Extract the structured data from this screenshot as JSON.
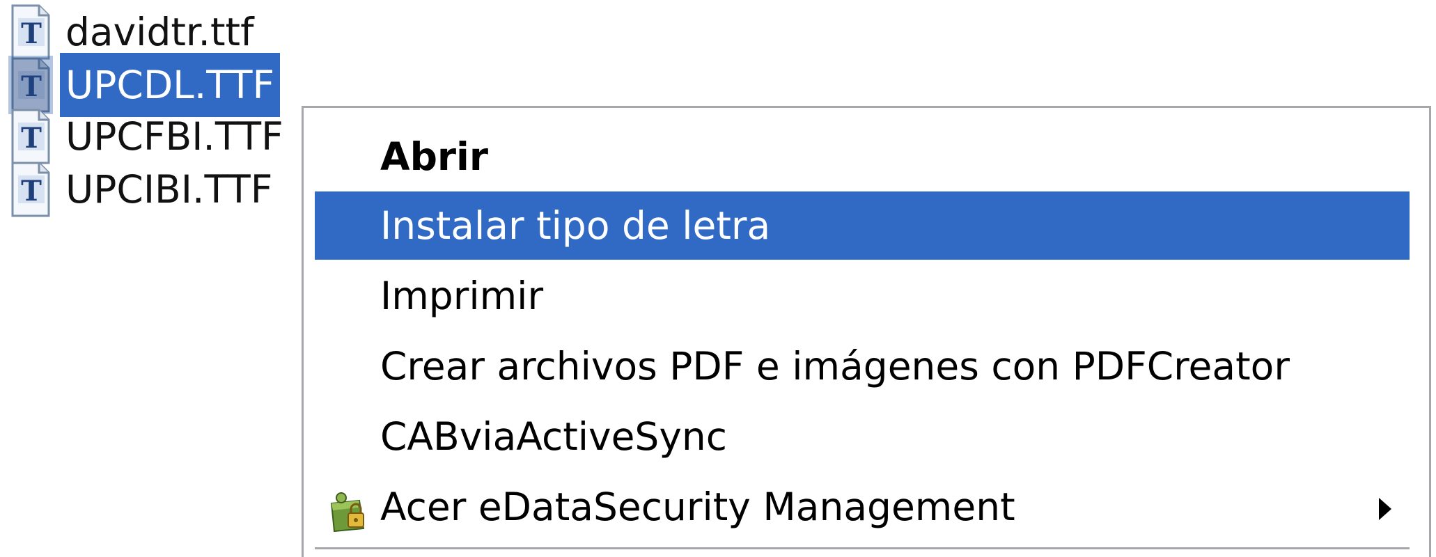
{
  "files": [
    {
      "name": "davidtr.ttf",
      "icon": "font-file-icon",
      "selected": false
    },
    {
      "name": "UPCDL.TTF",
      "icon": "font-file-icon",
      "selected": true
    },
    {
      "name": "UPCFBI.TTF",
      "icon": "font-file-icon",
      "selected": false
    },
    {
      "name": "UPCIBI.TTF",
      "icon": "font-file-icon",
      "selected": false
    }
  ],
  "context_menu": {
    "items": [
      {
        "label": "Abrir",
        "default": true
      },
      {
        "label": "Instalar tipo de letra",
        "highlighted": true
      },
      {
        "label": "Imprimir"
      },
      {
        "label": "Crear archivos PDF e imágenes con PDFCreator"
      },
      {
        "label": "CABviaActiveSync"
      },
      {
        "label": "Acer eDataSecurity Management",
        "icon": "acer-edatasecurity-icon",
        "has_submenu": true
      }
    ]
  },
  "colors": {
    "selection": "#316ac5",
    "menu_border": "#a7a6aa",
    "background": "#ffffff"
  }
}
